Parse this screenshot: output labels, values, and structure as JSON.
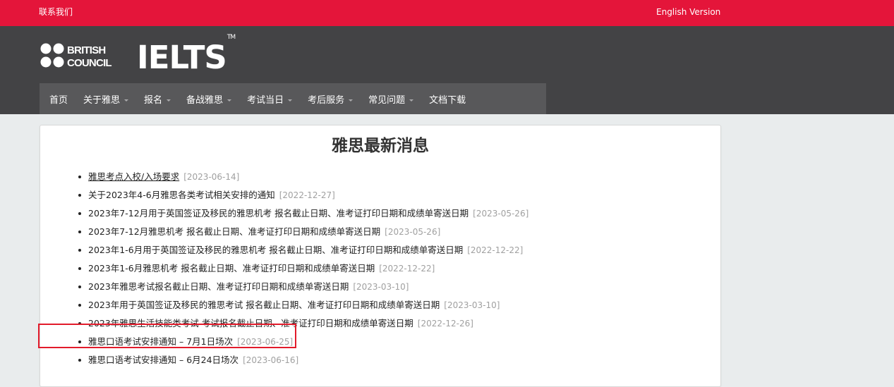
{
  "topbar": {
    "contact_label": "联系我们",
    "english_label": "English Version",
    "background": "#e4153a"
  },
  "header": {
    "logo_line1": "BRITISH",
    "logo_line2": "COUNCIL",
    "product": "IELTS",
    "trademark": "TM",
    "background": "#434345"
  },
  "nav": {
    "background": "#58585a",
    "items": [
      {
        "label": "首页",
        "dropdown": false
      },
      {
        "label": "关于雅思",
        "dropdown": true
      },
      {
        "label": "报名",
        "dropdown": true
      },
      {
        "label": "备战雅思",
        "dropdown": true
      },
      {
        "label": "考试当日",
        "dropdown": true
      },
      {
        "label": "考后服务",
        "dropdown": true
      },
      {
        "label": "常见问题",
        "dropdown": true
      },
      {
        "label": "文档下载",
        "dropdown": false
      }
    ]
  },
  "main": {
    "title": "雅思最新消息",
    "news": [
      {
        "title": "雅思考点入校/入场要求",
        "date": "[2023-06-14]"
      },
      {
        "title": "关于2023年4-6月雅思各类考试相关安排的通知",
        "date": "[2022-12-27]"
      },
      {
        "title": "2023年7-12月用于英国签证及移民的雅思机考 报名截止日期、准考证打印日期和成绩单寄送日期",
        "date": "[2023-05-26]"
      },
      {
        "title": "2023年7-12月雅思机考 报名截止日期、准考证打印日期和成绩单寄送日期",
        "date": "[2023-05-26]"
      },
      {
        "title": "2023年1-6月用于英国签证及移民的雅思机考 报名截止日期、准考证打印日期和成绩单寄送日期",
        "date": "[2022-12-22]"
      },
      {
        "title": "2023年1-6月雅思机考 报名截止日期、准考证打印日期和成绩单寄送日期",
        "date": "[2022-12-22]"
      },
      {
        "title": "2023年雅思考试报名截止日期、准考证打印日期和成绩单寄送日期",
        "date": "[2023-03-10]"
      },
      {
        "title": "2023年用于英国签证及移民的雅思考试 报名截止日期、准考证打印日期和成绩单寄送日期",
        "date": "[2023-03-10]"
      },
      {
        "title": "2023年雅思生活技能类考试 考试报名截止日期、准考证打印日期和成绩单寄送日期",
        "date": "[2022-12-26]"
      },
      {
        "title": "雅思口语考试安排通知 – 7月1日场次",
        "date": "[2023-06-25]"
      },
      {
        "title": "雅思口语考试安排通知 – 6月24日场次",
        "date": "[2023-06-16]"
      }
    ],
    "highlight_color": "#e21b2b"
  }
}
